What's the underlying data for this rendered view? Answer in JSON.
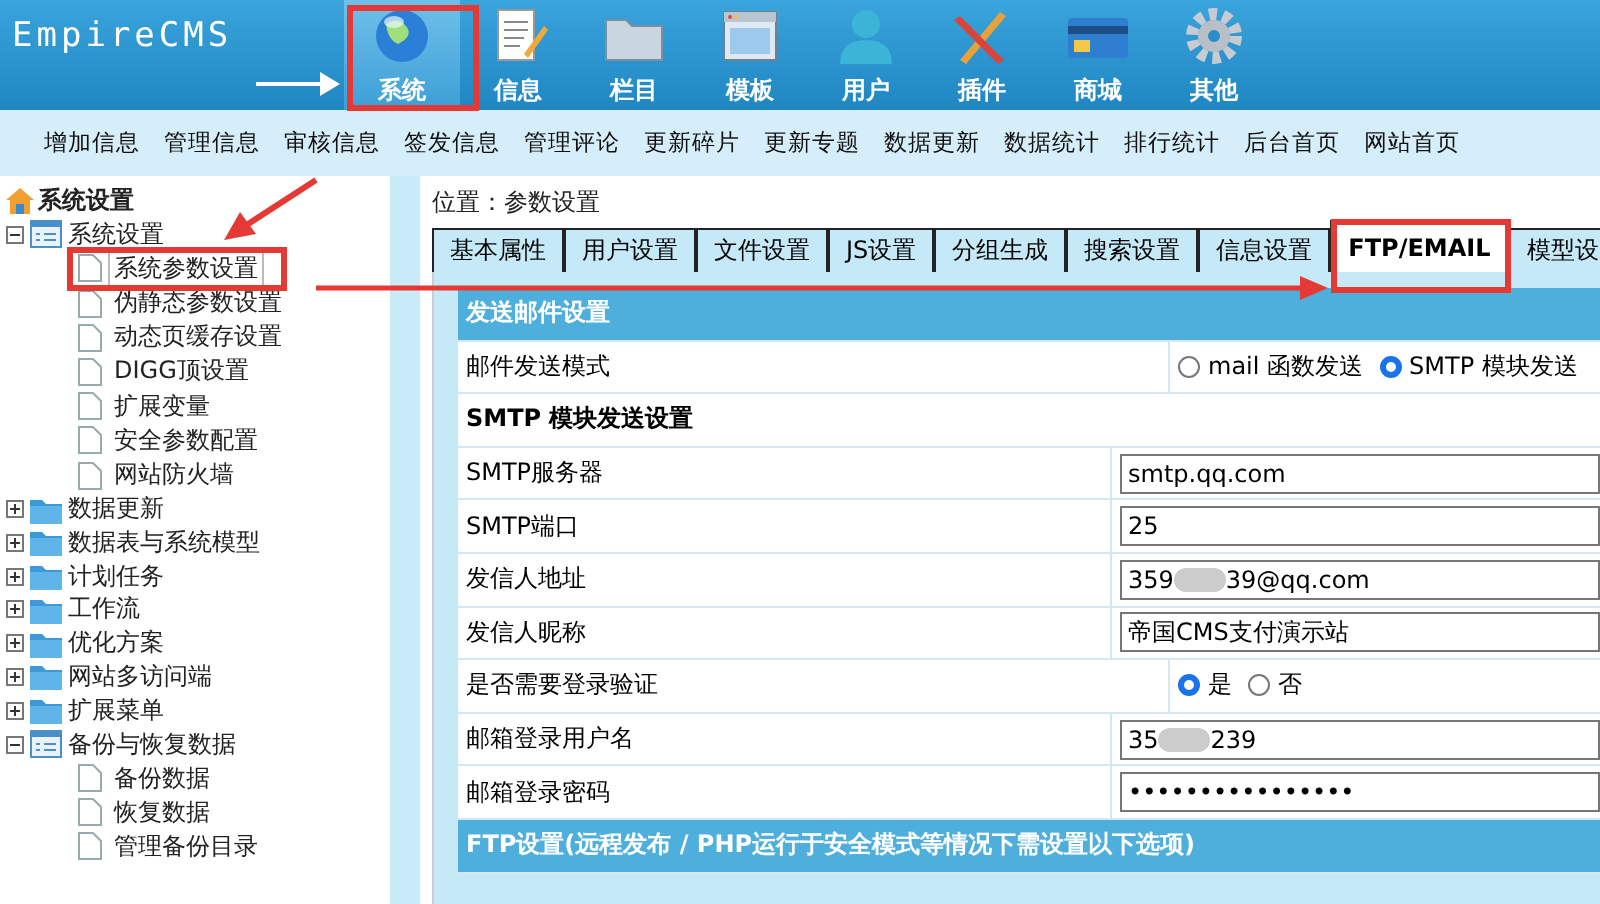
{
  "logo": {
    "text": "EmpireCMS"
  },
  "nav": [
    {
      "label": "系统",
      "selected": true
    },
    {
      "label": "信息",
      "selected": false
    },
    {
      "label": "栏目",
      "selected": false
    },
    {
      "label": "模板",
      "selected": false
    },
    {
      "label": "用户",
      "selected": false
    },
    {
      "label": "插件",
      "selected": false
    },
    {
      "label": "商城",
      "selected": false
    },
    {
      "label": "其他",
      "selected": false
    }
  ],
  "submenu": [
    "增加信息",
    "管理信息",
    "审核信息",
    "签发信息",
    "管理评论",
    "更新碎片",
    "更新专题",
    "数据更新",
    "数据统计",
    "排行统计",
    "后台首页",
    "网站首页"
  ],
  "sidebar": {
    "root": "系统设置",
    "tree": [
      {
        "label": "系统设置",
        "expanded": true,
        "children": [
          {
            "label": "系统参数设置",
            "selected": true
          },
          {
            "label": "伪静态参数设置",
            "selected": false
          },
          {
            "label": "动态页缓存设置",
            "selected": false
          },
          {
            "label": "DIGG顶设置",
            "selected": false
          },
          {
            "label": "扩展变量",
            "selected": false
          },
          {
            "label": "安全参数配置",
            "selected": false
          },
          {
            "label": "网站防火墙",
            "selected": false
          }
        ]
      },
      {
        "label": "数据更新",
        "expanded": false
      },
      {
        "label": "数据表与系统模型",
        "expanded": false
      },
      {
        "label": "计划任务",
        "expanded": false
      },
      {
        "label": "工作流",
        "expanded": false
      },
      {
        "label": "优化方案",
        "expanded": false
      },
      {
        "label": "网站多访问端",
        "expanded": false
      },
      {
        "label": "扩展菜单",
        "expanded": false
      },
      {
        "label": "备份与恢复数据",
        "expanded": true,
        "children": [
          {
            "label": "备份数据",
            "selected": false
          },
          {
            "label": "恢复数据",
            "selected": false
          },
          {
            "label": "管理备份目录",
            "selected": false
          }
        ]
      }
    ]
  },
  "location": {
    "label": "位置：",
    "value": "参数设置"
  },
  "tabs": [
    {
      "label": "基本属性",
      "selected": false
    },
    {
      "label": "用户设置",
      "selected": false
    },
    {
      "label": "文件设置",
      "selected": false
    },
    {
      "label": "JS设置",
      "selected": false
    },
    {
      "label": "分组生成",
      "selected": false
    },
    {
      "label": "搜索设置",
      "selected": false
    },
    {
      "label": "信息设置",
      "selected": false
    },
    {
      "label": "FTP/EMAIL",
      "selected": true
    },
    {
      "label": "模型设",
      "selected": false
    }
  ],
  "form": [
    {
      "kind": "header",
      "label": "发送邮件设置"
    },
    {
      "kind": "radio",
      "label": "邮件发送模式",
      "options": [
        {
          "label": "mail 函数发送",
          "selected": false
        },
        {
          "label": "SMTP 模块发送",
          "selected": true
        }
      ]
    },
    {
      "kind": "subheader",
      "label": "SMTP 模块发送设置"
    },
    {
      "kind": "text",
      "label": "SMTP服务器",
      "value": "smtp.qq.com"
    },
    {
      "kind": "text",
      "label": "SMTP端口",
      "value": "25"
    },
    {
      "kind": "redacted",
      "label": "发信人地址",
      "value_start": "359",
      "value_end": "39@qq.com"
    },
    {
      "kind": "text",
      "label": "发信人昵称",
      "value": "帝国CMS支付演示站"
    },
    {
      "kind": "radio",
      "label": "是否需要登录验证",
      "options": [
        {
          "label": "是",
          "selected": true
        },
        {
          "label": "否",
          "selected": false
        }
      ]
    },
    {
      "kind": "redacted",
      "label": "邮箱登录用户名",
      "value_start": "35",
      "value_end": "239"
    },
    {
      "kind": "text",
      "label": "邮箱登录密码",
      "value": "••••••••••••••••"
    },
    {
      "kind": "header",
      "label": "FTP设置(远程发布 / PHP运行于安全模式等情况下需设置以下选项)"
    }
  ]
}
